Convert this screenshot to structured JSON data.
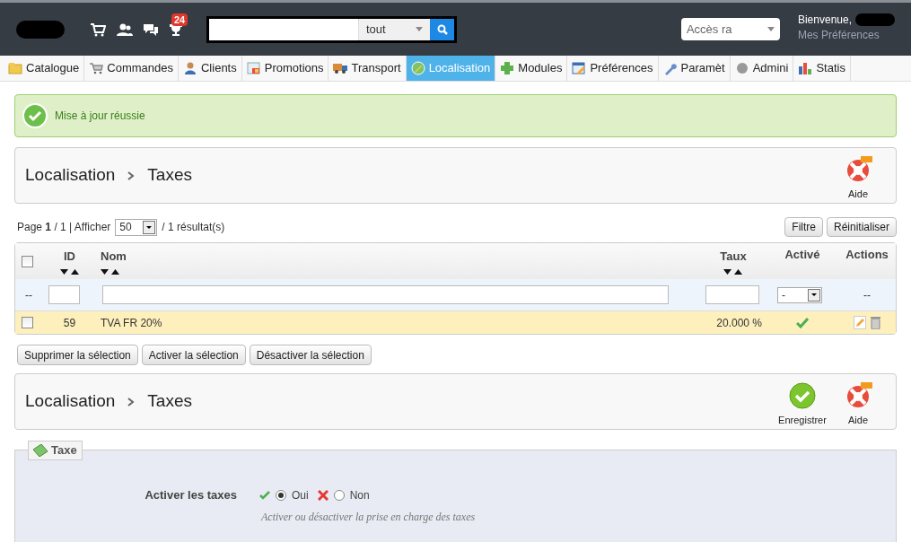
{
  "header": {
    "notification_count": "24",
    "search": {
      "scope": "tout"
    },
    "quick_access": "Accès ra",
    "welcome": "Bienvenue,",
    "preferences_link": "Mes Préférences"
  },
  "tabs": [
    {
      "label": "Catalogue",
      "selected": false
    },
    {
      "label": "Commandes",
      "selected": false
    },
    {
      "label": "Clients",
      "selected": false
    },
    {
      "label": "Promotions",
      "selected": false
    },
    {
      "label": "Transport",
      "selected": false
    },
    {
      "label": "Localisation",
      "selected": true
    },
    {
      "label": "Modules",
      "selected": false
    },
    {
      "label": "Préférences",
      "selected": false
    },
    {
      "label": "Paramèt",
      "selected": false
    },
    {
      "label": "Admini",
      "selected": false
    },
    {
      "label": "Statis",
      "selected": false
    }
  ],
  "alert": {
    "message": "Mise à jour réussie"
  },
  "list_toolbar": {
    "breadcrumb": [
      "Localisation",
      "Taxes"
    ],
    "actions": [
      {
        "kind": "help",
        "label": "Aide"
      }
    ]
  },
  "pagination": {
    "text": "Page **1** / 1 | Afficher",
    "per_page": "50",
    "results": "/ 1 résultat(s)"
  },
  "filter_buttons": [
    "Filtre",
    "Réinitialiser"
  ],
  "table": {
    "columns": [
      {
        "label": "ID",
        "sortable": true
      },
      {
        "label": "Nom",
        "sortable": true
      },
      {
        "label": "Taux",
        "sortable": true
      },
      {
        "label": "Activé",
        "sortable": false
      },
      {
        "label": "Actions",
        "sortable": false
      }
    ],
    "select_all_checked": false,
    "filters": {
      "select_all": "--",
      "active": "-",
      "actions": "--"
    },
    "rows": [
      {
        "selected": false,
        "id": "59",
        "name": "TVA FR 20%",
        "rate": "20.000 %",
        "enabled": true
      }
    ]
  },
  "bulk_actions": [
    "Supprimer la sélection",
    "Activer la sélection",
    "Désactiver la sélection"
  ],
  "form_toolbar": {
    "breadcrumb": [
      "Localisation",
      "Taxes"
    ],
    "actions": [
      {
        "kind": "save",
        "label": "Enregistrer"
      },
      {
        "kind": "help",
        "label": "Aide"
      }
    ]
  },
  "form": {
    "legend": "Taxe",
    "fields": [
      {
        "label": "Activer les taxes",
        "options": [
          {
            "kind": "yes",
            "label": "Oui",
            "selected": true
          },
          {
            "kind": "no",
            "label": "Non",
            "selected": false
          }
        ],
        "hint": "Activer ou désactiver la prise en charge des taxes"
      }
    ]
  }
}
